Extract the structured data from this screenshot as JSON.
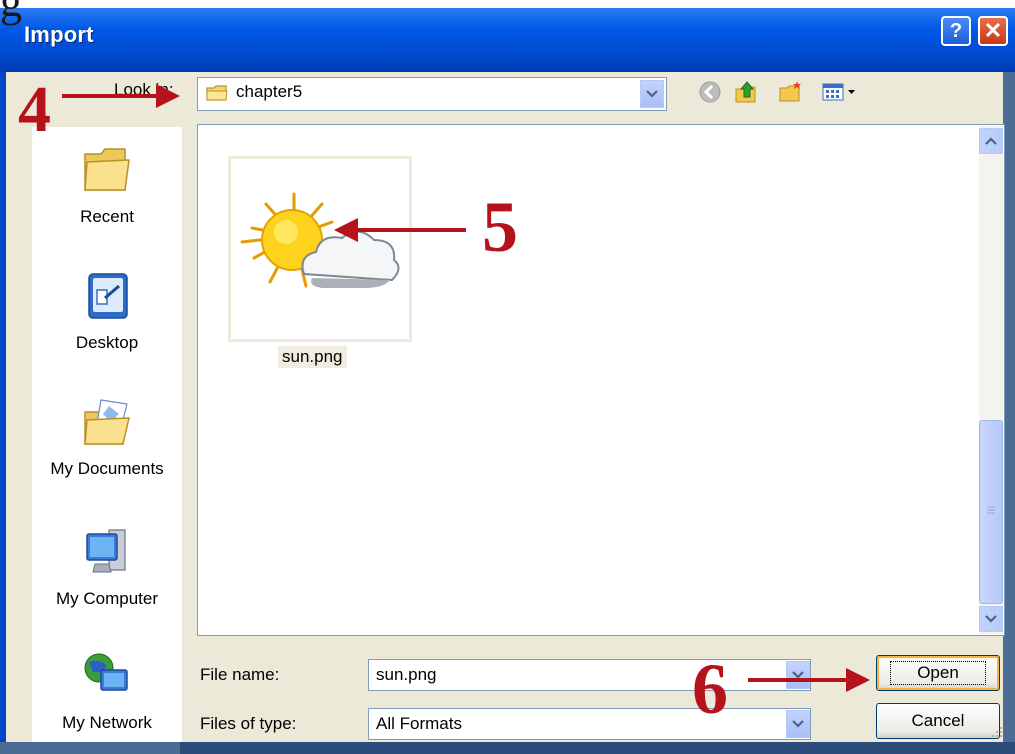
{
  "window": {
    "title": "Import"
  },
  "title_buttons": {
    "help": "?",
    "close": "✕"
  },
  "look_in": {
    "label": "Look in:",
    "value": "chapter5",
    "icon": "folder-icon"
  },
  "toolbar": {
    "icons": [
      "back-icon",
      "up-folder-icon",
      "new-folder-icon",
      "views-menu-icon"
    ]
  },
  "places": [
    {
      "label": "Recent",
      "icon": "recent-folder-icon"
    },
    {
      "label": "Desktop",
      "icon": "desktop-icon"
    },
    {
      "label": "My Documents",
      "icon": "my-documents-icon"
    },
    {
      "label": "My Computer",
      "icon": "my-computer-icon"
    },
    {
      "label": "My Network",
      "icon": "my-network-icon"
    }
  ],
  "files": [
    {
      "name": "sun.png",
      "thumbnail": "sun-cloud-image"
    }
  ],
  "file_name": {
    "label": "File name:",
    "value": "sun.png"
  },
  "file_type": {
    "label": "Files of type:",
    "value": "All Formats"
  },
  "buttons": {
    "open": "Open",
    "cancel": "Cancel"
  },
  "annotations": [
    "4",
    "5",
    "6"
  ],
  "colors": {
    "titlebar": "#0058E6",
    "annotation": "#B5121B",
    "dialog_bg": "#ECE9D8"
  }
}
